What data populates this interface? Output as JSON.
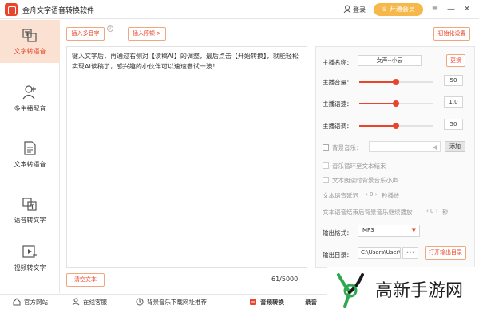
{
  "app": {
    "title": "金舟文字语音转换软件"
  },
  "titlebar": {
    "login_label": "登录",
    "vip_label": "开通会员"
  },
  "sidebar": {
    "items": [
      {
        "label": "文字转语音",
        "icon": "text-to-speech-icon",
        "active": true
      },
      {
        "label": "多主播配音",
        "icon": "add-user-icon"
      },
      {
        "label": "文本转语音",
        "icon": "document-icon"
      },
      {
        "label": "语音转文字",
        "icon": "speech-to-text-icon"
      },
      {
        "label": "视频转文字",
        "icon": "video-to-text-icon"
      }
    ]
  },
  "toolbar": {
    "insert_number_label": "插入多音字",
    "insert_pause_label": "插入停顿 >",
    "init_settings_label": "初始化设置"
  },
  "editor": {
    "text": "键入文字后，再通过右侧对【读稿AI】的调整，最后点击【开始转换】，就能轻松实现AI读稿了，感兴趣的小伙伴可以速速尝试一波！",
    "clear_label": "清空文本",
    "char_count": "61/5000"
  },
  "panel": {
    "anchor_name_label": "主播名称：",
    "anchor_name_value": "女声--小云",
    "change_label": "更换",
    "volume_label": "主播音量：",
    "volume_value": "50",
    "speed_label": "主播语速：",
    "speed_value": "1.0",
    "pitch_label": "主播语调：",
    "pitch_value": "50",
    "bgm_label": "背景音乐：",
    "add_label": "添加",
    "loop_label": "音乐循环至文本结束",
    "lower_label": "文本朗读时背景音乐小声",
    "delay_label": "文本语音延迟",
    "delay_value": "0",
    "delay_unit": "秒播放",
    "continue_label": "文本语音结束后背景音乐继续播放",
    "continue_value": "0",
    "continue_unit": "秒",
    "format_label": "输出格式：",
    "format_value": "MP3",
    "dir_label": "输出目录：",
    "dir_value": "C:\\Users\\User\\",
    "dir_more": "•••",
    "open_dir_label": "打开输出目录",
    "sliders": {
      "volume": 0.5,
      "speed": 0.5,
      "pitch": 0.5
    }
  },
  "bottombar": {
    "website_label": "官方网站",
    "service_label": "在线客服",
    "bgm_label": "背景音乐下载网址推荐",
    "audio_convert_label": "音频转换",
    "record_label": "录音"
  },
  "watermark": {
    "text": "高新手游网"
  },
  "colors": {
    "accent": "#e8452c",
    "vip": "#f6b84a",
    "active_bg": "#fbe1d2"
  }
}
